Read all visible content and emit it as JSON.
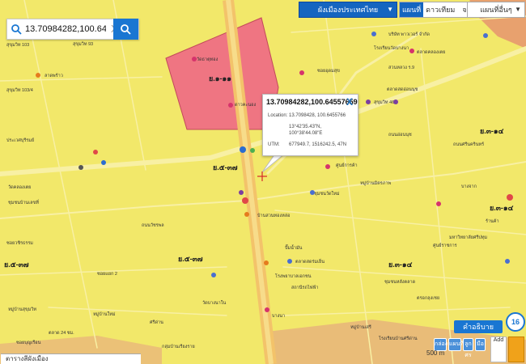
{
  "search": {
    "value": "13.70984282,100.64557659",
    "clear": "X"
  },
  "top_controls": {
    "province": "ผังเมืองประเทศไทย",
    "maptypes": [
      "แผนที่",
      "ดาวเทียม",
      "จราจร"
    ],
    "traffic_badge": "N",
    "layer": "แผนที่อื่นๆ"
  },
  "popup": {
    "title": "13.70984282,100.64557659",
    "close": "X",
    "location_label": "Location:",
    "location_value": "13.7098428, 100.6455766",
    "dms_lat": "13°42'35.43\"N,",
    "dms_lon": "100°38'44.08\"E",
    "utm_label": "UTM:",
    "utm_value": "677949.7, 1516242.5, 47N"
  },
  "zones": [
    {
      "label": "ย.๑-๑๑"
    },
    {
      "label": "ย.๕-๓๗"
    },
    {
      "label": "ย.๕-๓๗"
    },
    {
      "label": "ย.๕-๓๗"
    },
    {
      "label": "ย.๓-๑๔"
    },
    {
      "label": "ย.๓-๑๔"
    },
    {
      "label": "ย.๓-๑๔"
    }
  ],
  "places": [
    "สุขุมวิท 103",
    "สุขุมวิท 93",
    "ลาดพร้าว",
    "สุขุมวิท 103/4",
    "ประเวศบุรีรมย์",
    "วัดธาตุทอง",
    "ดาวคะนอง",
    "วัดคลองเตย",
    "ชุมชนบ้านเลขที่",
    "ซอยวชิรธรรม",
    "หมู่บ้านสุขุมวิท",
    "บริษัท พาวเวอร์ จำกัด",
    "โรงเรียนวัดบางนา",
    "ตลาดคลองเตย",
    "ซอยอุดมสุข",
    "สวนหลวง ร.9",
    "ตลาดสดอ่อนนุช",
    "สุขุมวิท 46",
    "ศูนย์การค้า",
    "หมู่บ้านมิตรภาพ",
    "ชุมชนวัดใหม่",
    "บ้านสวนทองหล่อ",
    "ปั๊มน้ำมัน",
    "ตลาดสดร่มเย็น",
    "ศูนย์ราชการ",
    "มหาวิทยาลัยศรีปทุม",
    "ถนนอ่อนนุช",
    "ถนนศรีนครินทร์",
    "บางจาก",
    "ร้านค้า",
    "โรงพยาบาลเอกชน",
    "สถานีรถไฟฟ้า",
    "ชุมชนหลังตลาด",
    "ตรอกลุงเชย",
    "บางนา",
    "หมู่บ้านเสรี",
    "ตลาด 24 ชม.",
    "ซอยบุญเรือน",
    "ศรีด่าน",
    "กลุ่มบ้านเรียงราย",
    "หมู่บ้านใหม่",
    "วัดบางนาใน",
    "โรงเรียนบ้านศรีด่าน",
    "ซอยแยก 2",
    "ถนนวัชรพล"
  ],
  "legend_button": "คำอธิบาย",
  "zoom_level": "16",
  "toolbar_icons": [
    "กล่อง",
    "แผนที่",
    "ลูกศร",
    "มือ"
  ],
  "scale_label": "500 m",
  "add_button": "Add",
  "bottom_panel": "ตารางสีผังเมือง",
  "colors": {
    "residential_yellow": "#f2e86a",
    "commercial_red": "#ef7582",
    "accent_blue": "#1976d2",
    "road_orange": "#f0a21a"
  }
}
